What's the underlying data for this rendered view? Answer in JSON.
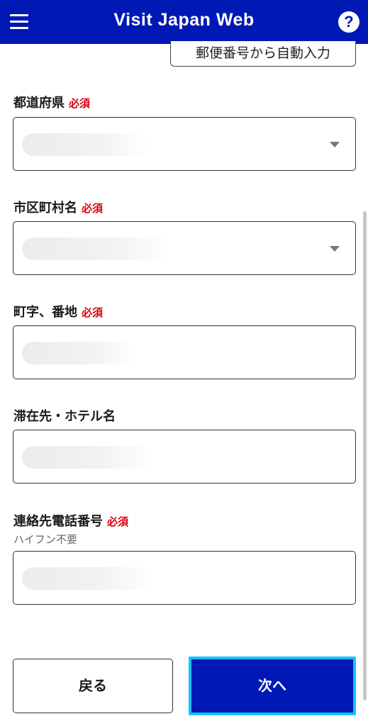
{
  "header": {
    "title": "Visit Japan Web",
    "menu_icon": "hamburger-menu-icon",
    "help_label": "?",
    "color": "#0019b4"
  },
  "zip_button": {
    "label": "郵便番号から自動入力"
  },
  "form": {
    "prefecture": {
      "label": "都道府県",
      "required": "必須",
      "value": ""
    },
    "city": {
      "label": "市区町村名",
      "required": "必須",
      "value": ""
    },
    "street": {
      "label": "町字、番地",
      "required": "必須",
      "value": ""
    },
    "hotel": {
      "label": "滞在先・ホテル名",
      "value": ""
    },
    "phone": {
      "label": "連絡先電話番号",
      "required": "必須",
      "hint": "ハイフン不要",
      "value": ""
    }
  },
  "footer": {
    "back_label": "戻る",
    "next_label": "次へ",
    "next_focus_color": "#16c2f7"
  }
}
